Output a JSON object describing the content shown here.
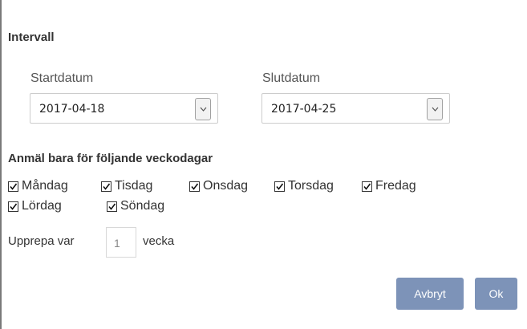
{
  "interval": {
    "title": "Intervall",
    "start": {
      "label": "Startdatum",
      "value": "2017-04-18"
    },
    "end": {
      "label": "Slutdatum",
      "value": "2017-04-25"
    }
  },
  "weekdays": {
    "title": "Anmäl bara för följande veckodagar",
    "days": [
      {
        "label": "Måndag",
        "checked": true
      },
      {
        "label": "Tisdag",
        "checked": true
      },
      {
        "label": "Onsdag",
        "checked": true
      },
      {
        "label": "Torsdag",
        "checked": true
      },
      {
        "label": "Fredag",
        "checked": true
      },
      {
        "label": "Lördag",
        "checked": true
      },
      {
        "label": "Söndag",
        "checked": true
      }
    ]
  },
  "repeat": {
    "prefix": "Upprepa var",
    "value": "1",
    "unit": "vecka"
  },
  "buttons": {
    "cancel": "Avbryt",
    "ok": "Ok"
  },
  "colors": {
    "button_bg": "#7d93b8",
    "border": "#cccccc"
  },
  "icons": {
    "dropdown": "chevron-down-icon",
    "checkbox": "checkmark-icon"
  }
}
